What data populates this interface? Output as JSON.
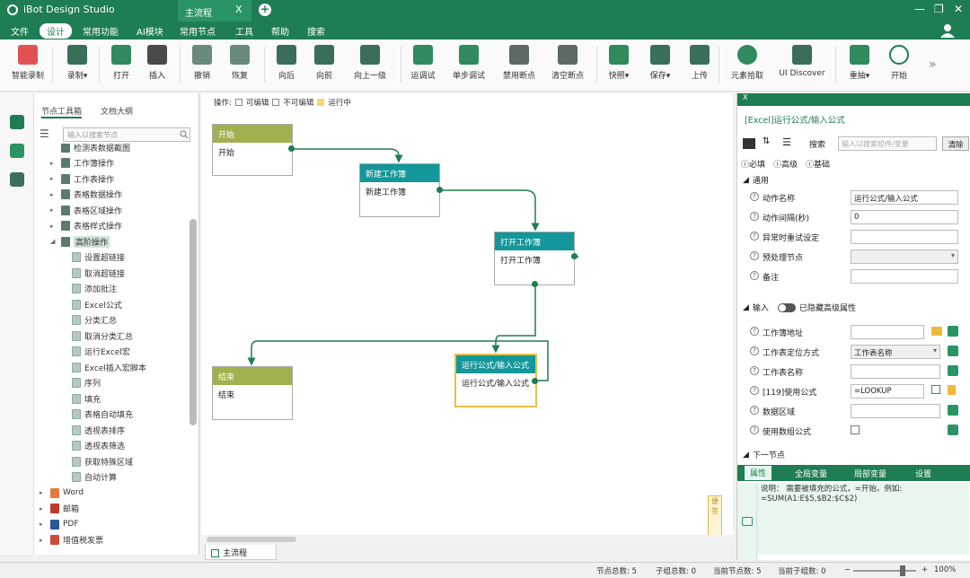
{
  "titlebar": {
    "app_name": "iBot Design Studio",
    "tab_label": "主流程",
    "tab_close": "X",
    "new_tab": "+",
    "minimize": "—",
    "restore": "❐",
    "close": "✕"
  },
  "menubar": {
    "items": [
      "文件",
      "设计",
      "常用功能",
      "AI模块",
      "常用节点",
      "工具",
      "帮助",
      "搜索"
    ],
    "active": "设计"
  },
  "toolbar": {
    "buttons": [
      "智能录制",
      "录制▾",
      "打开",
      "插入",
      "撤销",
      "恢复",
      "向后",
      "向前",
      "向上一级",
      "运调试",
      "单步调试",
      "禁用断点",
      "清空断点",
      "快照▾",
      "保存▾",
      "上传",
      "元素拾取",
      "UI Discover",
      "重抽▾",
      "开始"
    ],
    "more": "»"
  },
  "toolbox": {
    "tabs": [
      "节点工具箱",
      "文档大纲"
    ],
    "search_placeholder": "输入以搜索节点",
    "items": [
      {
        "label": "检测表数据截图",
        "level": 2,
        "arrow": ""
      },
      {
        "label": "工作簿操作",
        "level": 2,
        "arrow": "▸"
      },
      {
        "label": "工作表操作",
        "level": 2,
        "arrow": "▸"
      },
      {
        "label": "表格数据操作",
        "level": 2,
        "arrow": "▸"
      },
      {
        "label": "表格区域操作",
        "level": 2,
        "arrow": "▸"
      },
      {
        "label": "表格样式操作",
        "level": 2,
        "arrow": "▸"
      },
      {
        "label": "高阶操作",
        "level": 2,
        "arrow": "◢",
        "selected": true
      },
      {
        "label": "设置超链接",
        "level": 3,
        "arrow": ""
      },
      {
        "label": "取消超链接",
        "level": 3,
        "arrow": ""
      },
      {
        "label": "添加批注",
        "level": 3,
        "arrow": ""
      },
      {
        "label": "Excel公式",
        "level": 3,
        "arrow": ""
      },
      {
        "label": "分类汇总",
        "level": 3,
        "arrow": ""
      },
      {
        "label": "取消分类汇总",
        "level": 3,
        "arrow": ""
      },
      {
        "label": "运行Excel宏",
        "level": 3,
        "arrow": ""
      },
      {
        "label": "Excel插入宏脚本",
        "level": 3,
        "arrow": ""
      },
      {
        "label": "序列",
        "level": 3,
        "arrow": ""
      },
      {
        "label": "填充",
        "level": 3,
        "arrow": ""
      },
      {
        "label": "表格自动填充",
        "level": 3,
        "arrow": ""
      },
      {
        "label": "透视表排序",
        "level": 3,
        "arrow": ""
      },
      {
        "label": "透视表筛选",
        "level": 3,
        "arrow": ""
      },
      {
        "label": "获取特殊区域",
        "level": 3,
        "arrow": ""
      },
      {
        "label": "自动计算",
        "level": 3,
        "arrow": ""
      },
      {
        "label": "Word",
        "level": 1,
        "arrow": "▸"
      },
      {
        "label": "邮箱",
        "level": 1,
        "arrow": "▸"
      },
      {
        "label": "PDF",
        "level": 1,
        "arrow": "▸"
      },
      {
        "label": "增值税发票",
        "level": 1,
        "arrow": "▸"
      }
    ]
  },
  "canvas": {
    "legend_prefix": "操作:",
    "legend": [
      "可编辑",
      "不可编辑",
      "运行中"
    ],
    "legend_colors": [
      "#ffffff",
      "#ffffff",
      "#f5d76e"
    ],
    "nodes": {
      "start": {
        "header": "开始",
        "body": "开始"
      },
      "new_wb": {
        "header": "新建工作簿",
        "body": "新建工作簿"
      },
      "open_wb": {
        "header": "打开工作簿",
        "body": "打开工作簿"
      },
      "formula": {
        "header": "运行公式/输入公式",
        "body": "运行公式/输入公式"
      },
      "end": {
        "header": "结束",
        "body": "结束"
      }
    },
    "note": "便签"
  },
  "bottom_tab": "主流程",
  "props": {
    "topbar": "X",
    "title": "[Excel]运行公式/输入公式",
    "search_label": "搜索",
    "search_placeholder": "输入以搜索组件/变量",
    "clear_label": "清除",
    "modes": [
      "必填",
      "高级",
      "基础"
    ],
    "general_header": "通用",
    "general": [
      {
        "label": "动作名称",
        "value": "运行公式/输入公式"
      },
      {
        "label": "动作间隔(秒)",
        "value": "0"
      },
      {
        "label": "异常时重试设定",
        "value": ""
      },
      {
        "label": "预处理节点",
        "value": ""
      },
      {
        "label": "备注",
        "value": ""
      }
    ],
    "input_header": "输入",
    "input_toggle": "已隐藏高级属性",
    "inputs": [
      {
        "label": "工作簿地址",
        "value": ""
      },
      {
        "label": "工作表定位方式",
        "value": "工作表名称"
      },
      {
        "label": "工作表名称",
        "value": ""
      },
      {
        "label": "[119]使用公式",
        "value": "=LOOKUP"
      },
      {
        "label": "数据区域",
        "value": ""
      },
      {
        "label": "使用数组公式",
        "value": ""
      }
    ],
    "next_header": "下一节点",
    "bottom_tabs": [
      "属性",
      "全局变量",
      "局部变量",
      "设置"
    ],
    "help_text": "说明：   需要被填充的公式，=开始。例如: =SUM(A1:E$5,$B2:$C$2)"
  },
  "status": {
    "node_total": "节点总数: 5",
    "subgroup_total": "子组总数: 0",
    "current_nodes": "当前节点数: 5",
    "current_subgroups": "当前子组数: 0",
    "zoom": "100%",
    "zoom_minus": "−",
    "zoom_plus": "+"
  },
  "colors": {
    "brand": "#1e7d52",
    "teal_header": "#13979a",
    "olive_header": "#a3b04f",
    "edge": "#1e7d52",
    "selected_border": "#e5c04a"
  }
}
